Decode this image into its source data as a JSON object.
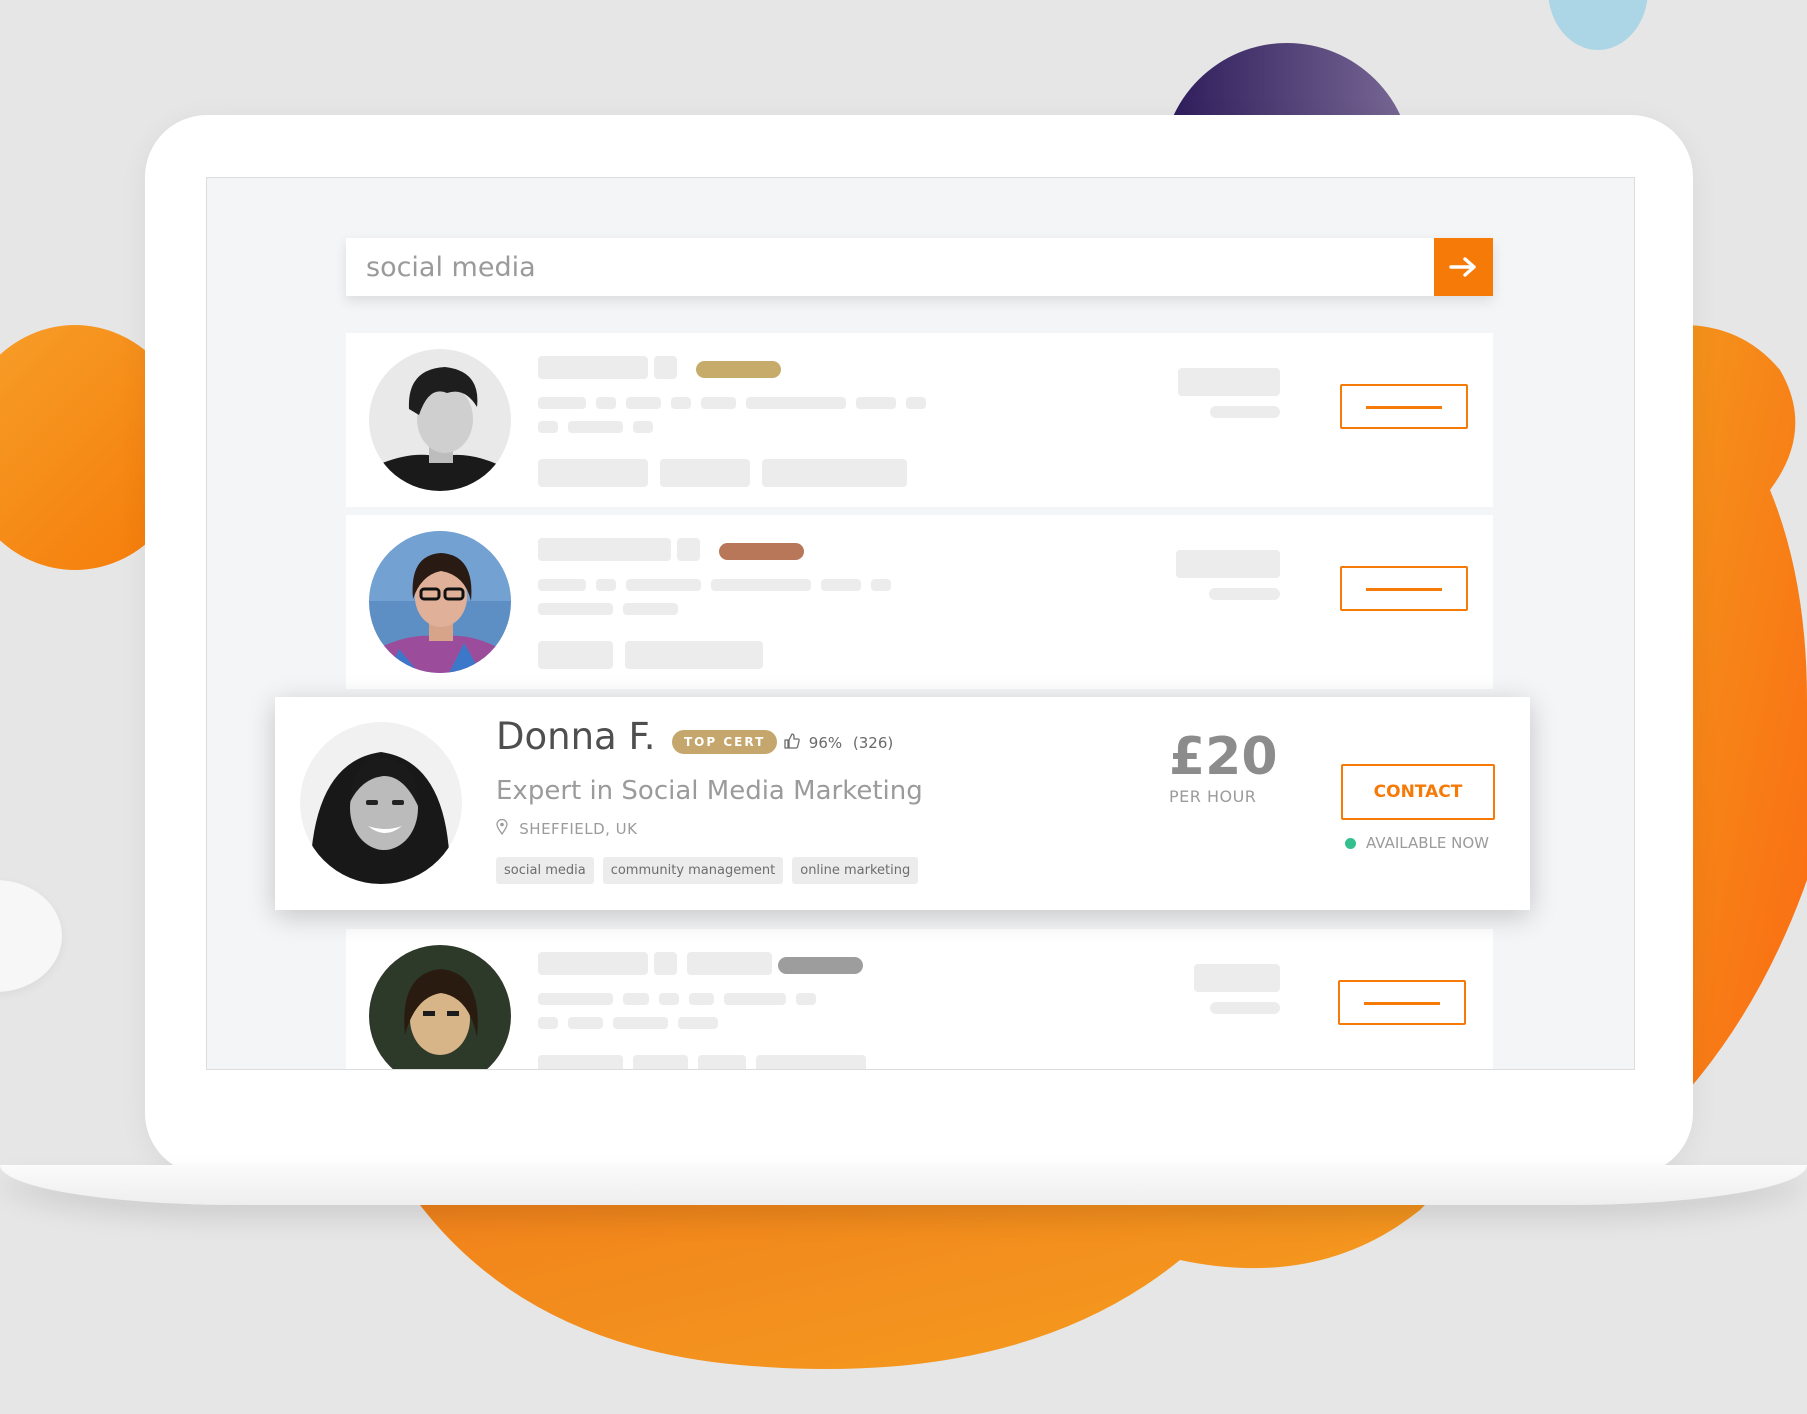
{
  "search": {
    "value": "social media",
    "submit_icon": "arrow-right-icon"
  },
  "colors": {
    "accent": "#f57a08",
    "top_cert_badge": "#c5a66d",
    "available": "#34c08e",
    "background": "#e6e6e6"
  },
  "featured_profile": {
    "name": "Donna F.",
    "badge": "TOP CERT",
    "rating_icon": "thumbs-up-icon",
    "rating_percent": "96%",
    "rating_count": "(326)",
    "headline": "Expert in Social Media Marketing",
    "location_icon": "map-pin-icon",
    "location": "SHEFFIELD, UK",
    "tags": [
      "social media",
      "community management",
      "online marketing"
    ],
    "price": "£20",
    "price_unit": "PER HOUR",
    "contact_label": "CONTACT",
    "availability": "AVAILABLE NOW"
  },
  "placeholder_profiles": [
    {
      "badge_color": "#c6ab6a",
      "avatar": "avatar-man-dark-hair"
    },
    {
      "badge_color": "#b77758",
      "avatar": "avatar-woman-glasses"
    },
    {
      "badge_color": "#9d9d9d",
      "avatar": "avatar-man-long-hair"
    }
  ]
}
